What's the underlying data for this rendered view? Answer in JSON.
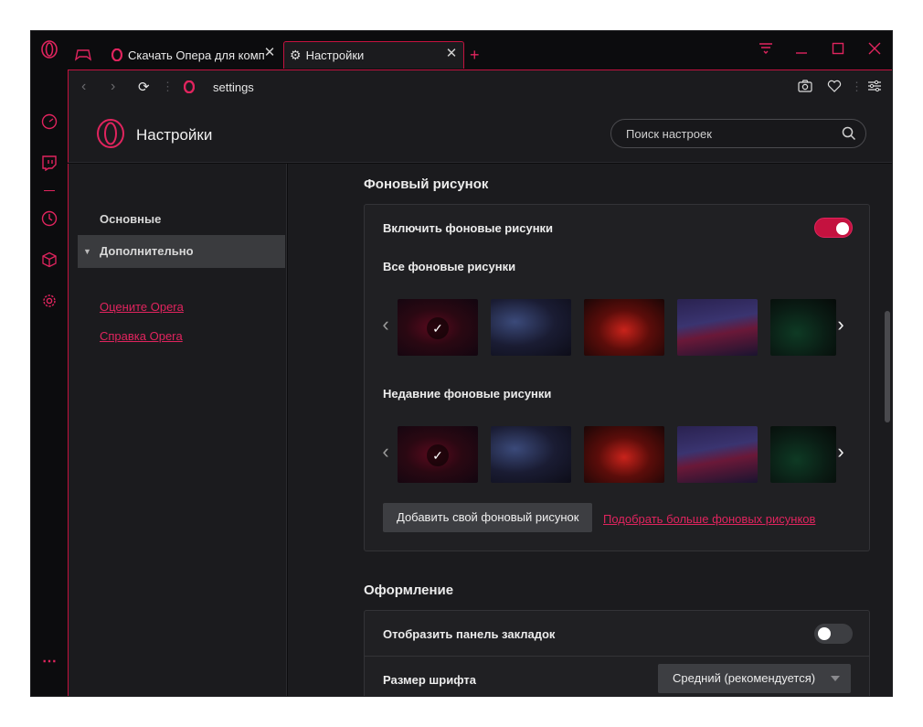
{
  "tabs": [
    {
      "label": "Скачать Опера для компь",
      "active": false
    },
    {
      "label": "Настройки",
      "active": true
    }
  ],
  "new_tab_label": "+",
  "address": "settings",
  "header": {
    "title": "Настройки",
    "search_placeholder": "Поиск настроек"
  },
  "sidebar": {
    "items": [
      {
        "label": "Основные",
        "selected": false
      },
      {
        "label": "Дополнительно",
        "selected": true
      }
    ],
    "links": [
      "Оцените Opera",
      "Справка Opera"
    ]
  },
  "wallpaper": {
    "section_title": "Фоновый рисунок",
    "enable_label": "Включить фоновые рисунки",
    "enabled": true,
    "all_label": "Все фоновые рисунки",
    "recent_label": "Недавние фоновые рисунки",
    "add_button": "Добавить свой фоновый рисунок",
    "more_link": "Подобрать больше фоновых рисунков",
    "selected_index": 0
  },
  "appearance": {
    "section_title": "Оформление",
    "bookmarks_label": "Отобразить панель закладок",
    "bookmarks_enabled": false,
    "font_size_label": "Размер шрифта",
    "font_size_value": "Средний (рекомендуется)"
  },
  "colors": {
    "accent": "#c4123f",
    "link": "#e0245e",
    "bg": "#1b1b1e",
    "card": "#202023"
  }
}
